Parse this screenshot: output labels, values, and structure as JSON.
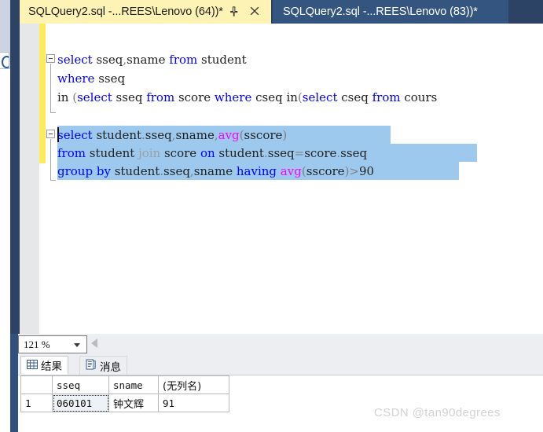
{
  "window": {
    "tabs": [
      {
        "title": "SQLQuery2.sql -...REES\\Lenovo (64))*",
        "active": true,
        "pin_icon": "pin-icon",
        "close_icon": "close-icon"
      },
      {
        "title": "SQLQuery2.sql -...REES\\Lenovo (83))*",
        "active": false
      }
    ]
  },
  "editor": {
    "lines": [
      {
        "n": 1,
        "selected": false,
        "tokens": [
          {
            "t": "select",
            "c": "kw"
          },
          {
            "t": " sseq",
            "c": "plain"
          },
          {
            "t": ",",
            "c": "punct"
          },
          {
            "t": "sname ",
            "c": "plain"
          },
          {
            "t": "from",
            "c": "kw"
          },
          {
            "t": " student",
            "c": "plain"
          }
        ]
      },
      {
        "n": 2,
        "selected": false,
        "tokens": [
          {
            "t": "where",
            "c": "kw"
          },
          {
            "t": " sseq",
            "c": "plain"
          }
        ]
      },
      {
        "n": 3,
        "selected": false,
        "tokens": [
          {
            "t": "in ",
            "c": "plain"
          },
          {
            "t": "(",
            "c": "punct"
          },
          {
            "t": "select",
            "c": "kw"
          },
          {
            "t": " sseq ",
            "c": "plain"
          },
          {
            "t": "from",
            "c": "kw"
          },
          {
            "t": " score ",
            "c": "plain"
          },
          {
            "t": "where",
            "c": "kw"
          },
          {
            "t": " cseq ",
            "c": "plain"
          },
          {
            "t": "in",
            "c": "plain"
          },
          {
            "t": "(",
            "c": "punct"
          },
          {
            "t": "select",
            "c": "kw"
          },
          {
            "t": " cseq ",
            "c": "plain"
          },
          {
            "t": "from",
            "c": "kw"
          },
          {
            "t": " cours",
            "c": "plain"
          }
        ]
      },
      {
        "n": 4,
        "selected": true,
        "tokens": [
          {
            "t": "select",
            "c": "kw"
          },
          {
            "t": " student",
            "c": "plain"
          },
          {
            "t": ".",
            "c": "punct"
          },
          {
            "t": "sseq",
            "c": "plain"
          },
          {
            "t": ",",
            "c": "punct"
          },
          {
            "t": "sname",
            "c": "plain"
          },
          {
            "t": ",",
            "c": "punct"
          },
          {
            "t": "avg",
            "c": "fn"
          },
          {
            "t": "(",
            "c": "punct"
          },
          {
            "t": "sscore",
            "c": "plain"
          },
          {
            "t": ")",
            "c": "punct"
          }
        ]
      },
      {
        "n": 5,
        "selected": true,
        "tokens": [
          {
            "t": "from",
            "c": "kw"
          },
          {
            "t": " student ",
            "c": "plain"
          },
          {
            "t": "join",
            "c": "joinkw"
          },
          {
            "t": " score ",
            "c": "plain"
          },
          {
            "t": "on",
            "c": "kw"
          },
          {
            "t": " student",
            "c": "plain"
          },
          {
            "t": ".",
            "c": "punct"
          },
          {
            "t": "sseq",
            "c": "plain"
          },
          {
            "t": "=",
            "c": "punct"
          },
          {
            "t": "score",
            "c": "plain"
          },
          {
            "t": ".",
            "c": "punct"
          },
          {
            "t": "sseq",
            "c": "plain"
          }
        ]
      },
      {
        "n": 6,
        "selected": true,
        "tokens": [
          {
            "t": "group",
            "c": "kw"
          },
          {
            "t": " ",
            "c": "plain"
          },
          {
            "t": "by",
            "c": "kw"
          },
          {
            "t": " student",
            "c": "plain"
          },
          {
            "t": ".",
            "c": "punct"
          },
          {
            "t": "sseq",
            "c": "plain"
          },
          {
            "t": ",",
            "c": "punct"
          },
          {
            "t": "sname ",
            "c": "plain"
          },
          {
            "t": "having",
            "c": "kw"
          },
          {
            "t": " ",
            "c": "plain"
          },
          {
            "t": "avg",
            "c": "fn"
          },
          {
            "t": "(",
            "c": "punct"
          },
          {
            "t": "sscore",
            "c": "plain"
          },
          {
            "t": ")",
            "c": "punct"
          },
          {
            "t": ">",
            "c": "punct"
          },
          {
            "t": "90",
            "c": "plain"
          }
        ]
      }
    ],
    "selection_color": "#9dc9ee",
    "change_bar_color": "#fcec5c"
  },
  "statusbar": {
    "zoom_value": "121 %",
    "zoom_dropdown_icon": "chevron-down-icon",
    "scroll_left_icon": "scroll-left-arrow-icon"
  },
  "results": {
    "tabs": [
      {
        "label": "结果",
        "icon": "grid-icon",
        "active": true
      },
      {
        "label": "消息",
        "icon": "message-icon",
        "active": false
      }
    ],
    "grid": {
      "columns": [
        "",
        "sseq",
        "sname",
        "(无列名)"
      ],
      "rows": [
        {
          "num": "1",
          "sseq": "060101",
          "sname": "钟文辉",
          "unnamed": "91"
        }
      ]
    }
  },
  "watermark": {
    "text": "CSDN @tan90degrees"
  }
}
